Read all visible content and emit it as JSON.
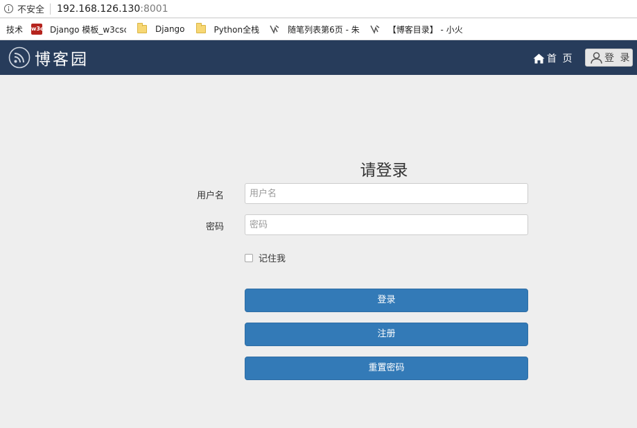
{
  "browser": {
    "security_label": "不安全",
    "url_host": "192.168.126.130",
    "url_port": ":8001",
    "bookmarks": [
      {
        "label": "技术",
        "icon": "none"
      },
      {
        "label": "Django 模板_w3csc",
        "icon": "w3c-icon",
        "icon_text": "w3c"
      },
      {
        "label": "Django",
        "icon": "folder-icon"
      },
      {
        "label": "Python全栈",
        "icon": "folder-icon"
      },
      {
        "label": "随笔列表第6页 - 朱",
        "icon": "cnblogs-icon"
      },
      {
        "label": "【博客目录】 - 小火",
        "icon": "cnblogs-icon"
      }
    ]
  },
  "navbar": {
    "brand": "博客园",
    "home_label": "首 页",
    "login_label": "登 录",
    "background": "#273c5b"
  },
  "form": {
    "title": "请登录",
    "username_label": "用户名",
    "username_placeholder": "用户名",
    "password_label": "密码",
    "password_placeholder": "密码",
    "remember_label": "记住我",
    "login_button": "登录",
    "register_button": "注册",
    "reset_button": "重置密码",
    "button_color": "#337ab7"
  }
}
